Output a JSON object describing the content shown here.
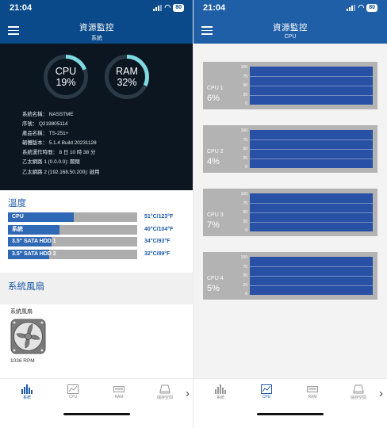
{
  "status_bar": {
    "time": "21:04",
    "battery": "80"
  },
  "left_screen": {
    "header": {
      "title": "資源監控",
      "subtitle": "系統"
    },
    "gauges": [
      {
        "label": "CPU",
        "value": "19%",
        "fraction": 0.19
      },
      {
        "label": "RAM",
        "value": "32%",
        "fraction": 0.32
      }
    ],
    "system_info": [
      "系統名稱： NASSTME",
      "序號： Q219805114",
      "產品名稱： TS-251+",
      "韌體版本： 5.1.4 Build 20231128",
      "系統運作時間： 8 日 10 時 38 分",
      "乙太網路 1 (0.0.0.0): 關閉",
      "乙太網路 2 (192.168.50.200): 啟用"
    ],
    "temperature": {
      "title": "溫度",
      "rows": [
        {
          "name": "CPU",
          "value": "51°C/123°F",
          "fraction": 0.51
        },
        {
          "name": "系統",
          "value": "40°C/104°F",
          "fraction": 0.4
        },
        {
          "name": "3.5\" SATA HDD 1",
          "value": "34°C/93°F",
          "fraction": 0.34
        },
        {
          "name": "3.5\" SATA HDD 2",
          "value": "32°C/89°F",
          "fraction": 0.32
        }
      ]
    },
    "fan": {
      "title": "系統風扇",
      "label": "系統風扇",
      "rpm": "1036 RPM"
    },
    "active_tab": 0
  },
  "right_screen": {
    "header": {
      "title": "資源監控",
      "subtitle": "CPU"
    },
    "y_ticks": [
      "100",
      "75",
      "50",
      "25",
      "0"
    ],
    "cpus": [
      {
        "name": "CPU 1",
        "value": "6%"
      },
      {
        "name": "CPU 2",
        "value": "4%"
      },
      {
        "name": "CPU 3",
        "value": "7%"
      },
      {
        "name": "CPU 4",
        "value": "5%"
      }
    ],
    "active_tab": 1
  },
  "tabs": [
    {
      "label": "系統",
      "icon": "bar-chart-icon"
    },
    {
      "label": "CPU",
      "icon": "cpu-chart-icon"
    },
    {
      "label": "RAM",
      "icon": "ram-icon"
    },
    {
      "label": "儲存空間",
      "icon": "storage-icon"
    }
  ],
  "colors": {
    "header_blue": "#0a4a8a",
    "accent_blue": "#1d5aa8",
    "gauge_teal": "#7fd9e0",
    "panel_dark": "#0b1621"
  }
}
